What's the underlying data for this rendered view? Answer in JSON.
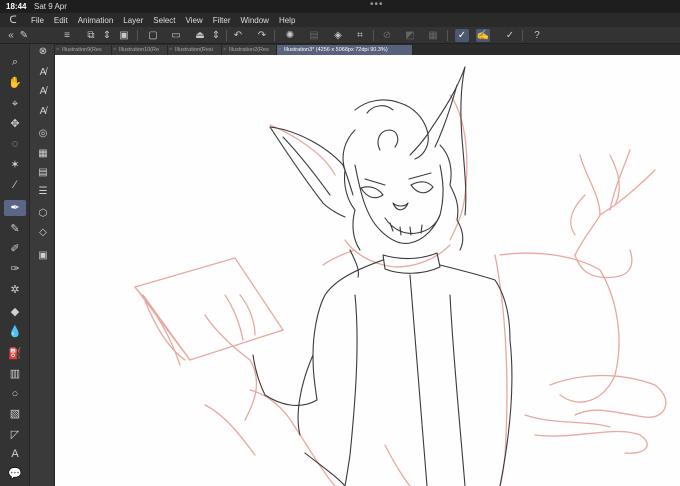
{
  "status": {
    "time": "18:44",
    "date": "Sat 9 Apr",
    "dots": "•••"
  },
  "menu": [
    "File",
    "Edit",
    "Animation",
    "Layer",
    "Select",
    "View",
    "Filter",
    "Window",
    "Help"
  ],
  "tabs": [
    {
      "label": "Illustration9(Res"
    },
    {
      "label": "Illustration10(Re"
    },
    {
      "label": "Illustration(Resi"
    },
    {
      "label": "Illustration2(Res"
    },
    {
      "label": "Illustration3* (4256 x 5068px 72dpi 90.3%)"
    }
  ],
  "colors": {
    "sketch": "#e8a8a0",
    "lineart": "#3a3a3a",
    "accent": "#58627d"
  }
}
